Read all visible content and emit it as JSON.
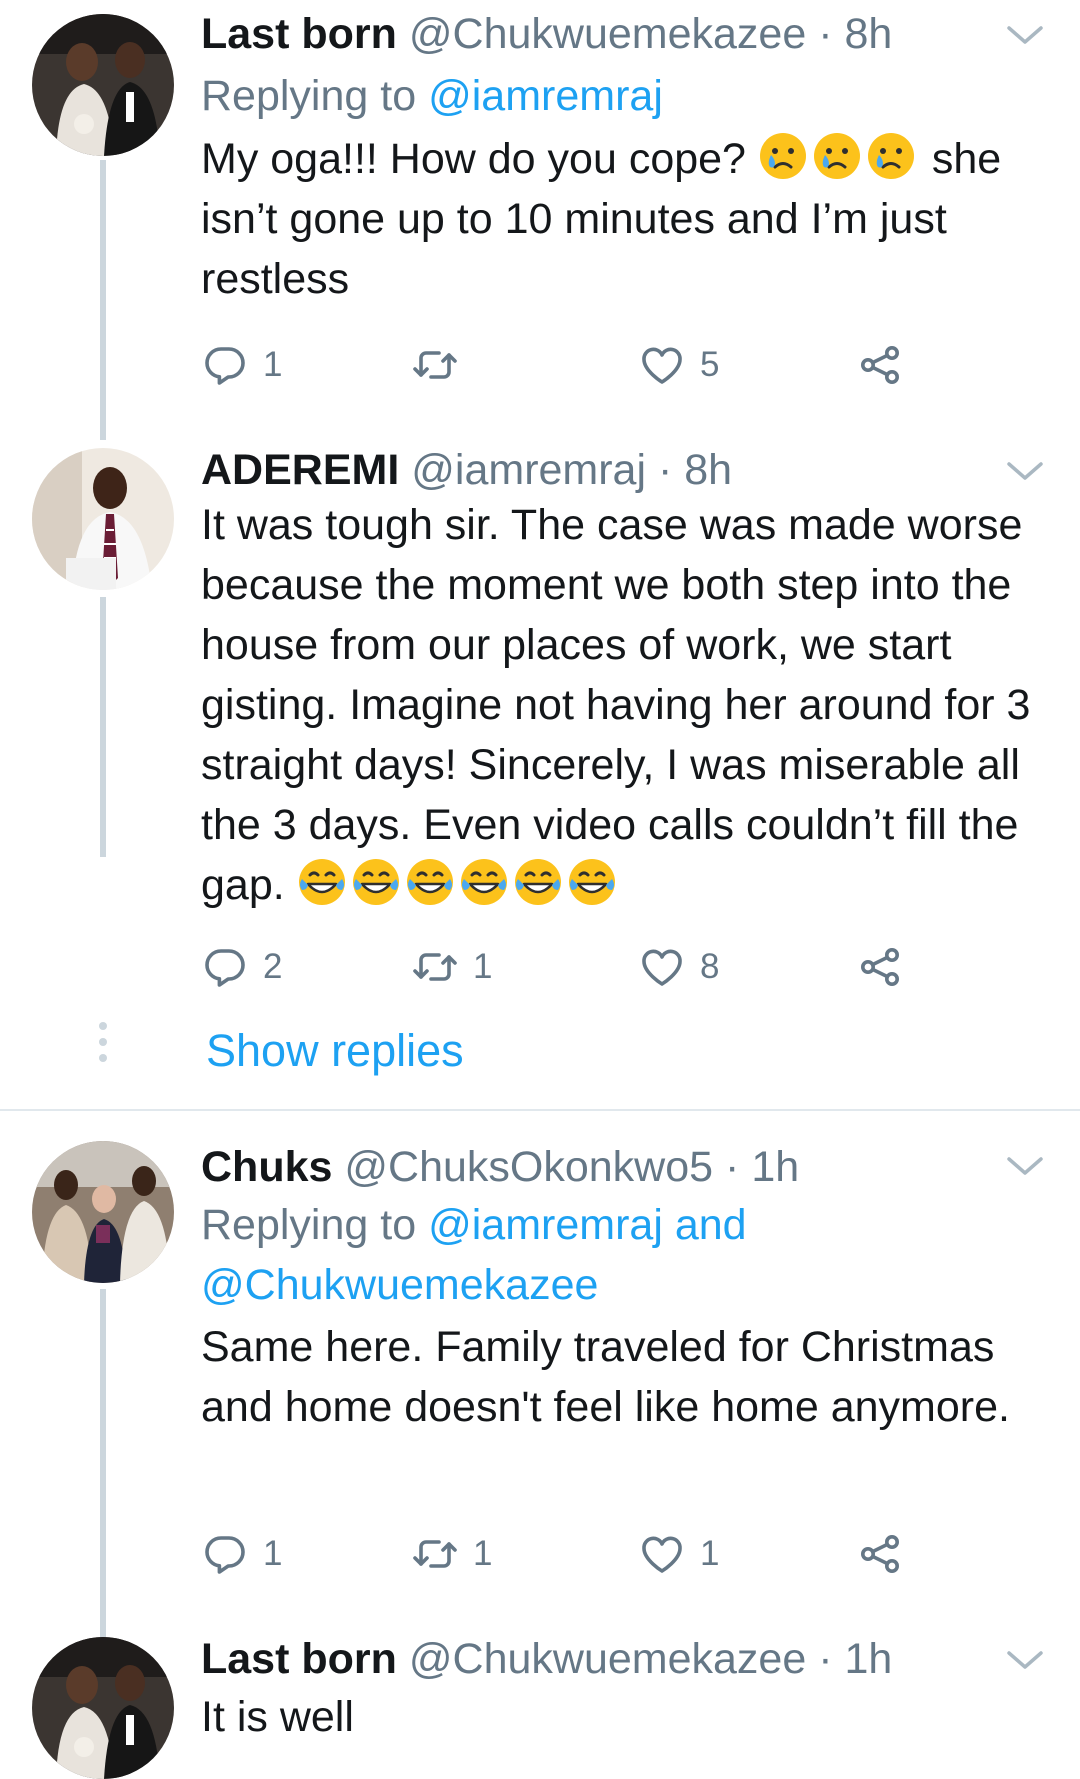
{
  "tweets": [
    {
      "name": "Last born",
      "handle": "@Chukwuemekazee",
      "separator": "·",
      "time": "8h",
      "replying_prefix": "Replying to",
      "replying_to": "@iamremraj",
      "text_before_emoji": "My oga!!! How do you cope?",
      "emojis": [
        "crying-face",
        "crying-face",
        "crying-face"
      ],
      "text_after_emoji": "she isn’t gone up to 10 minutes and I’m just restless",
      "replies": "1",
      "retweets": "",
      "likes": "5"
    },
    {
      "name": "ADEREMI",
      "handle": "@iamremraj",
      "separator": "·",
      "time": "8h",
      "text": "It was tough sir. The case was made worse because the moment we both step into the house from our places of work, we start gisting. Imagine not having her around for 3 straight days! Sincerely, I was miserable all the 3 days. Even video calls couldn’t fill the gap.",
      "emojis": [
        "tears-of-joy",
        "tears-of-joy",
        "tears-of-joy",
        "tears-of-joy",
        "tears-of-joy",
        "tears-of-joy"
      ],
      "replies": "2",
      "retweets": "1",
      "likes": "8"
    },
    {
      "name": "Chuks",
      "handle": "@ChuksOkonkwo5",
      "separator": "·",
      "time": "1h",
      "replying_prefix": "Replying to",
      "replying_to_1": "@iamremraj",
      "replying_and": "and",
      "replying_to_2": "@Chukwuemekazee",
      "text": "Same here. Family traveled for Christmas and home doesn't feel like home anymore.",
      "replies": "1",
      "retweets": "1",
      "likes": "1"
    },
    {
      "name": "Last born",
      "handle": "@Chukwuemekazee",
      "separator": "·",
      "time": "1h",
      "text": "It is well"
    }
  ],
  "show_replies_label": "Show replies",
  "colors": {
    "link_blue": "#1da1f2",
    "secondary_gray": "#657786",
    "text_dark": "#14171a",
    "thread_line": "#ccd6dd",
    "divider": "#e1e8ed"
  },
  "icons": [
    "reply-icon",
    "retweet-icon",
    "like-icon",
    "share-icon",
    "chevron-down-icon"
  ]
}
